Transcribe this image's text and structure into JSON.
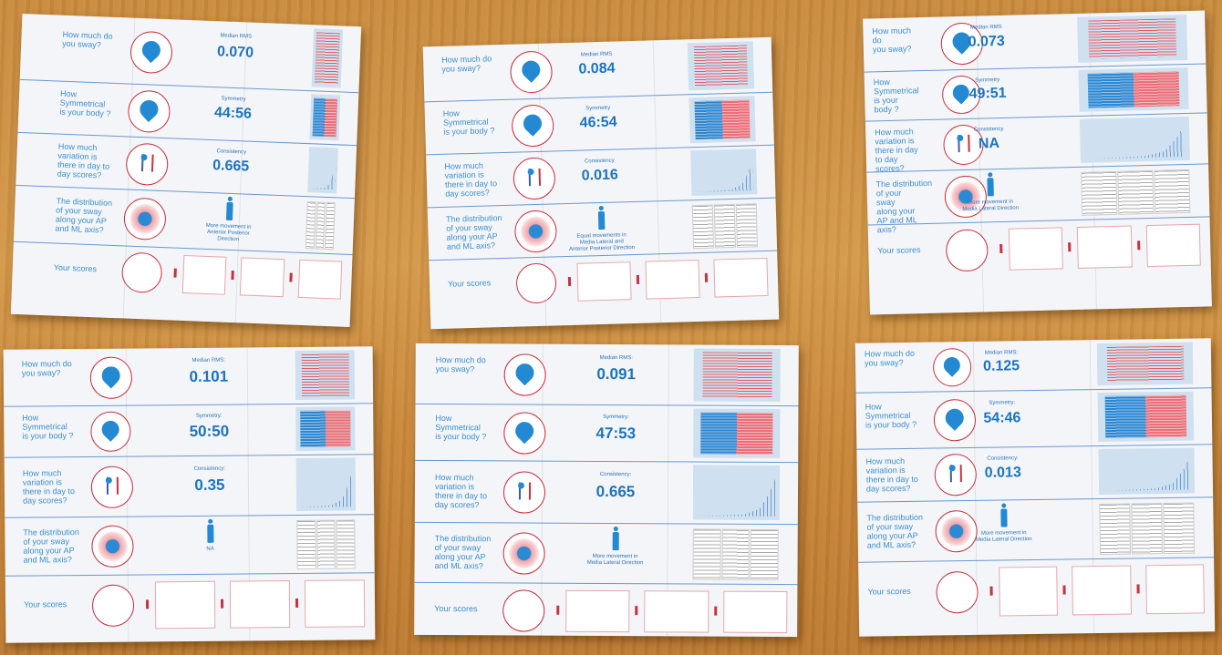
{
  "sheets": [
    {
      "questions": [
        "How much do\nyou sway?",
        "How\nSymmetrical\nis your body ?",
        "How much\nvariation is\nthere in day to\nday scores?",
        "The distribution\nof your sway\nalong your AP\nand ML axis?"
      ],
      "metrics": [
        {
          "label": "Median RMS",
          "value": "0.070"
        },
        {
          "label": "Symmetry",
          "value": "44:56"
        },
        {
          "label": "Consistency",
          "value": "0.665"
        }
      ],
      "distribution_note": "More movement in\nAnterior Posterior\nDirection",
      "scores_label": "Your scores"
    },
    {
      "questions": [
        "How much do\nyou sway?",
        "How\nSymmetrical\nis your body ?",
        "How much\nvariation is\nthere in day to\nday scores?",
        "The distribution\nof your sway\nalong your AP\nand ML axis?"
      ],
      "metrics": [
        {
          "label": "Median RMS",
          "value": "0.084"
        },
        {
          "label": "Symmetry",
          "value": "46:54"
        },
        {
          "label": "Consistency",
          "value": "0.016"
        }
      ],
      "distribution_note": "Equal movements in\nMedia Lateral and\nAnterior Posterior Direction",
      "scores_label": "Your scores"
    },
    {
      "questions": [
        "How much\ndo\nyou sway?",
        "How\nSymmetrical\nis your\nbody ?",
        "How much\nvariation is\nthere in day\nto day\nscores?",
        "The distribution\nof your\nsway\nalong your\nAP and ML\naxis?"
      ],
      "metrics": [
        {
          "label": "Median RMS",
          "value": "0.073"
        },
        {
          "label": "Symmetry",
          "value": "49:51"
        },
        {
          "label": "Consistency",
          "value": "NA"
        }
      ],
      "distribution_note": "More movement in\nMedia Lateral Direction",
      "scores_label": "Your scores"
    },
    {
      "questions": [
        "How much do\nyou sway?",
        "How\nSymmetrical\nis your body ?",
        "How much\nvariation is\nthere in day to\nday scores?",
        "The distribution\nof your sway\nalong your AP\nand ML axis?"
      ],
      "metrics": [
        {
          "label": "Median RMS:",
          "value": "0.101"
        },
        {
          "label": "Symmetry:",
          "value": "50:50"
        },
        {
          "label": "Consistency:",
          "value": "0.35"
        }
      ],
      "distribution_note": "NA",
      "scores_label": "Your scores"
    },
    {
      "questions": [
        "How much do\nyou sway?",
        "How\nSymmetrical\nis your body ?",
        "How much\nvariation is\nthere in day to\nday scores?",
        "The distribution\nof your sway\nalong your AP\nand ML axis?"
      ],
      "metrics": [
        {
          "label": "Median RMS:",
          "value": "0.091"
        },
        {
          "label": "Symmetry:",
          "value": "47:53"
        },
        {
          "label": "Consistency:",
          "value": "0.665"
        }
      ],
      "distribution_note": "More movement in\nMedia Lateral Direction",
      "scores_label": "Your scores"
    },
    {
      "questions": [
        "How much do\nyou sway?",
        "How\nSymmetrical\nis your body ?",
        "How much\nvariation is\nthere in day to\nday scores?",
        "The distribution\nof your sway\nalong your AP\nand ML axis?"
      ],
      "metrics": [
        {
          "label": "Median RMS:",
          "value": "0.125"
        },
        {
          "label": "Symmetry:",
          "value": "54:46"
        },
        {
          "label": "Consistency:",
          "value": "0.013"
        }
      ],
      "distribution_note": "More movement in\nMedia Lateral Direction",
      "scores_label": "Your scores"
    }
  ],
  "colors": {
    "accent": "#1c74c0",
    "icon_ring": "#c8313f",
    "table_wood": "#c98a3c"
  }
}
